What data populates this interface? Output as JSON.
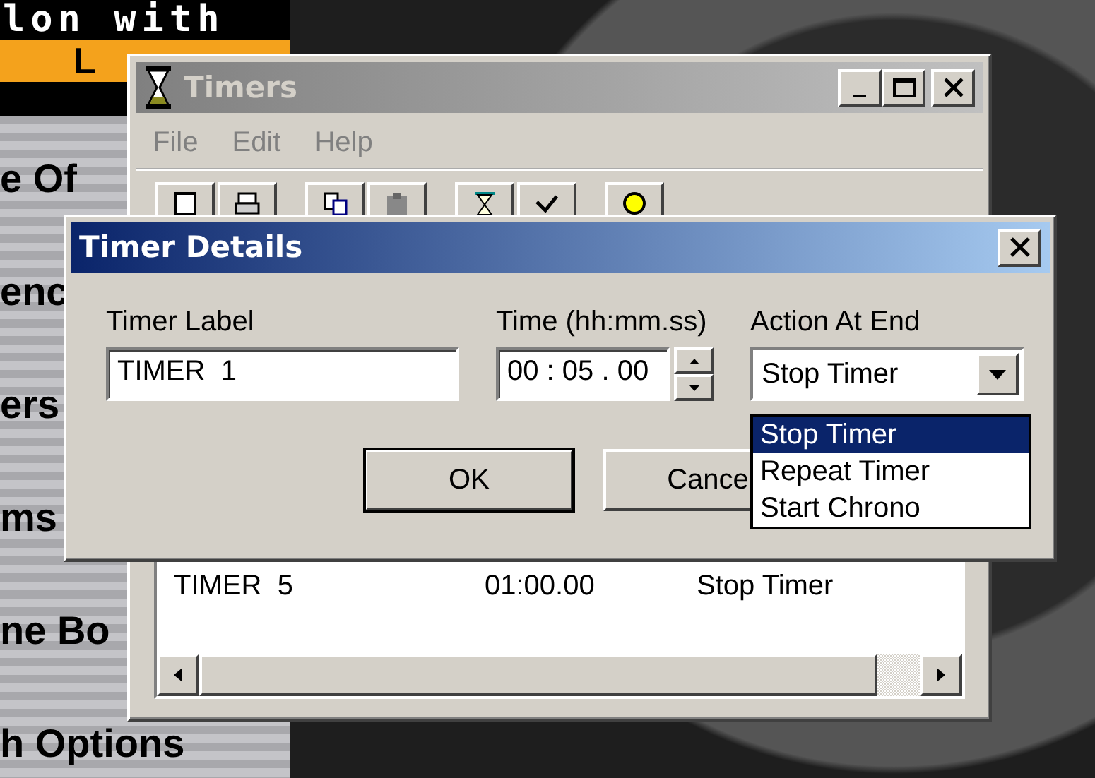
{
  "background_page": {
    "banner_text": "lon with",
    "banner_letter": "L",
    "headings": [
      "e Of",
      "enc",
      "ers",
      "ms",
      "ne Bo",
      "h Options"
    ]
  },
  "timers_window": {
    "title": "Timers",
    "active": false,
    "menu": [
      {
        "label": "File",
        "disabled": true
      },
      {
        "label": "Edit",
        "disabled": true
      },
      {
        "label": "Help",
        "disabled": true
      }
    ],
    "rows": [
      {
        "label": "TIMER  5",
        "time": "01:00.00",
        "action": "Stop Timer"
      }
    ]
  },
  "dialog": {
    "title": "Timer Details",
    "active": true,
    "fields": [
      {
        "kind": "text",
        "label": "Timer Label",
        "value": "TIMER  1"
      },
      {
        "kind": "time",
        "label": "Time (hh:mm.ss)",
        "value": "00 : 05 . 00"
      },
      {
        "kind": "combo",
        "label": "Action At End",
        "value": "Stop Timer"
      }
    ],
    "buttons": [
      {
        "label": "OK",
        "default": true
      },
      {
        "label": "Cance",
        "default": false
      }
    ],
    "dropdown_options": [
      {
        "label": "Stop Timer",
        "selected": true
      },
      {
        "label": "Repeat Timer",
        "selected": false
      },
      {
        "label": "Start Chrono",
        "selected": false
      }
    ]
  }
}
